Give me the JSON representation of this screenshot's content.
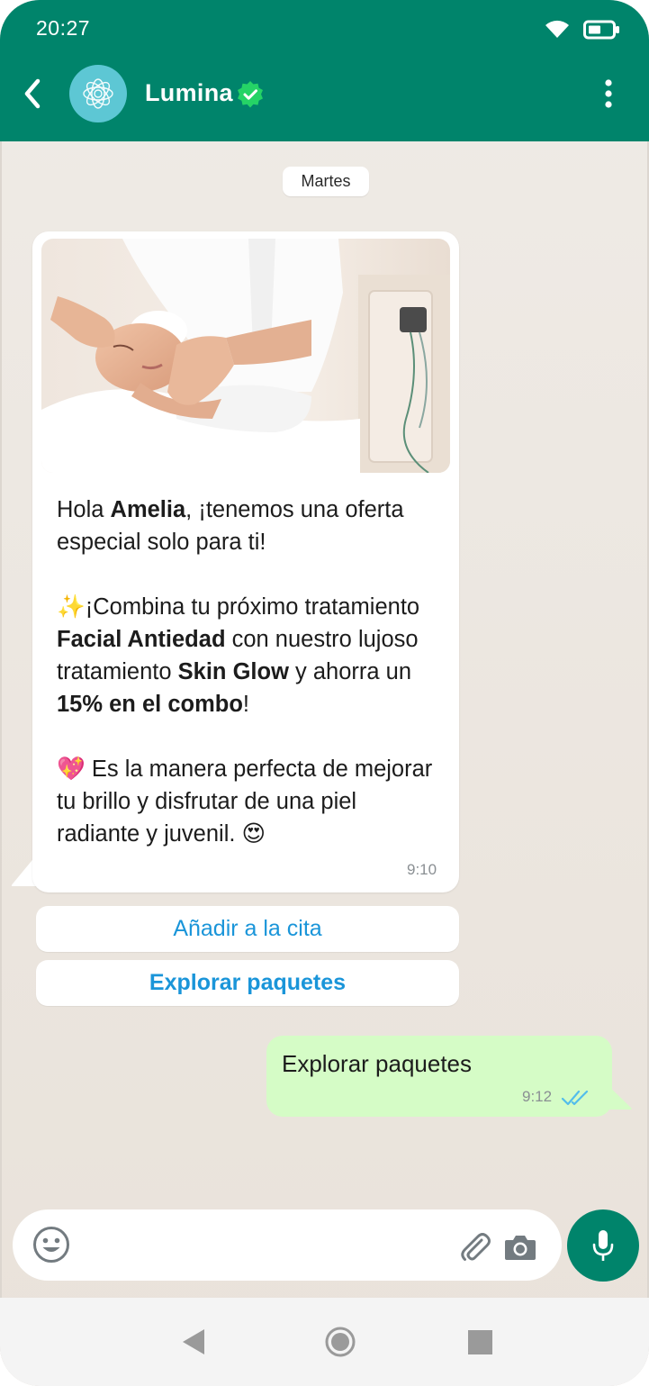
{
  "status_bar": {
    "time": "20:27"
  },
  "header": {
    "contact_name": "Lumina",
    "icons": [
      "back-arrow-icon",
      "lumina-logo-icon",
      "verified-check-icon",
      "more-vert-icon"
    ],
    "colors": {
      "bar": "#00846b",
      "verified": "#25d366",
      "avatar": "#5dc7d4"
    }
  },
  "chat": {
    "date_chip": "Martes",
    "incoming": {
      "image": "facial-massage-photo",
      "paragraphs": [
        [
          {
            "text": "Hola ",
            "bold": false
          },
          {
            "text": "Amelia",
            "bold": true
          },
          {
            "text": ", ¡tenemos una oferta especial solo para ti!",
            "bold": false
          }
        ],
        [
          {
            "text": "✨",
            "bold": false
          },
          {
            "text": "¡Combina tu próximo tratamiento ",
            "bold": false
          },
          {
            "text": "Facial Antiedad",
            "bold": true
          },
          {
            "text": " con nuestro lujoso tratamiento ",
            "bold": false
          },
          {
            "text": "Skin Glow",
            "bold": true
          },
          {
            "text": " y ahorra un ",
            "bold": false
          },
          {
            "text": "15% en el combo",
            "bold": true
          },
          {
            "text": "!",
            "bold": false
          }
        ],
        [
          {
            "text": "💖",
            "bold": false
          },
          {
            "text": " Es la manera perfecta de mejorar tu brillo y disfrutar de una piel radiante y juvenil. ",
            "bold": false
          },
          {
            "text": "😍",
            "bold": false
          }
        ]
      ],
      "time": "9:10"
    },
    "quick_replies": [
      {
        "label": "Añadir a la cita"
      },
      {
        "label": "Explorar paquetes"
      }
    ],
    "outgoing": {
      "text": "Explorar paquetes",
      "time": "9:12",
      "status": "read"
    },
    "colors": {
      "outgoing_bubble": "#d5fcc6",
      "link": "#1a95d9",
      "read_checks": "#53bdeb"
    }
  },
  "composer": {
    "icons": [
      "emoji-icon",
      "attach-icon",
      "camera-icon",
      "mic-icon"
    ]
  },
  "nav_bar": {
    "icons": [
      "nav-back-icon",
      "nav-home-icon",
      "nav-recents-icon"
    ]
  }
}
